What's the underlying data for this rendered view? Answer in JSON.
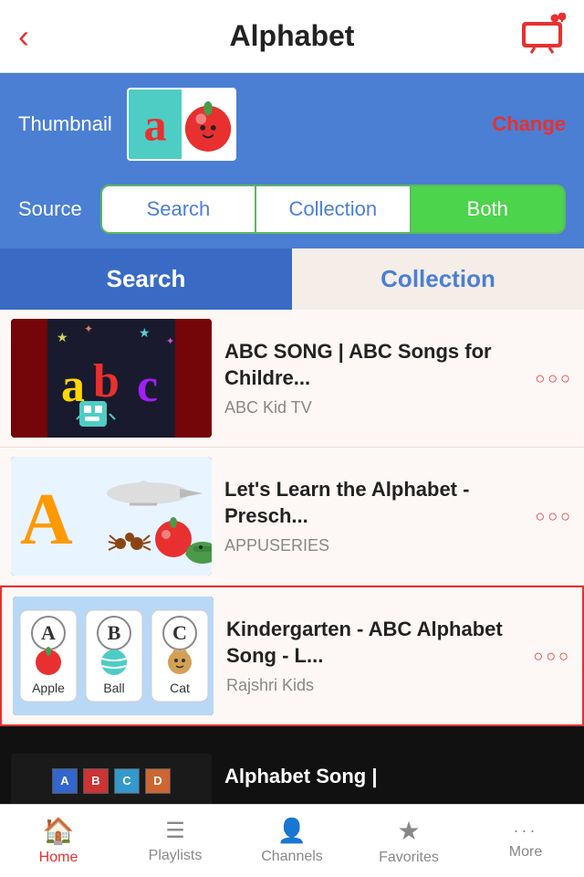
{
  "header": {
    "title": "Alphabet",
    "back_label": "‹",
    "icon_alt": "tv-icon"
  },
  "thumbnail": {
    "label": "Thumbnail",
    "change_label": "Change"
  },
  "source": {
    "label": "Source",
    "buttons": [
      {
        "label": "Search",
        "active": false
      },
      {
        "label": "Collection",
        "active": false
      },
      {
        "label": "Both",
        "active": true
      }
    ]
  },
  "tabs": [
    {
      "label": "Search",
      "active": true
    },
    {
      "label": "Collection",
      "active": false
    }
  ],
  "videos": [
    {
      "title": "ABC SONG | ABC Songs for Childre...",
      "channel": "ABC Kid TV",
      "more": "○○○"
    },
    {
      "title": "Let's Learn the Alphabet - Presch...",
      "channel": "APPUSERIES",
      "more": "○○○"
    },
    {
      "title": "Kindergarten - ABC Alphabet Song - L...",
      "channel": "Rajshri Kids",
      "more": "○○○",
      "selected": true
    },
    {
      "title": "Alphabet Song |",
      "channel": "",
      "more": "",
      "partial": true
    }
  ],
  "bottom_nav": [
    {
      "label": "Home",
      "icon": "🏠",
      "active": true
    },
    {
      "label": "Playlists",
      "icon": "☰",
      "active": false
    },
    {
      "label": "Channels",
      "icon": "👤",
      "active": false
    },
    {
      "label": "Favorites",
      "icon": "★",
      "active": false
    },
    {
      "label": "More",
      "icon": "···",
      "active": false
    }
  ]
}
